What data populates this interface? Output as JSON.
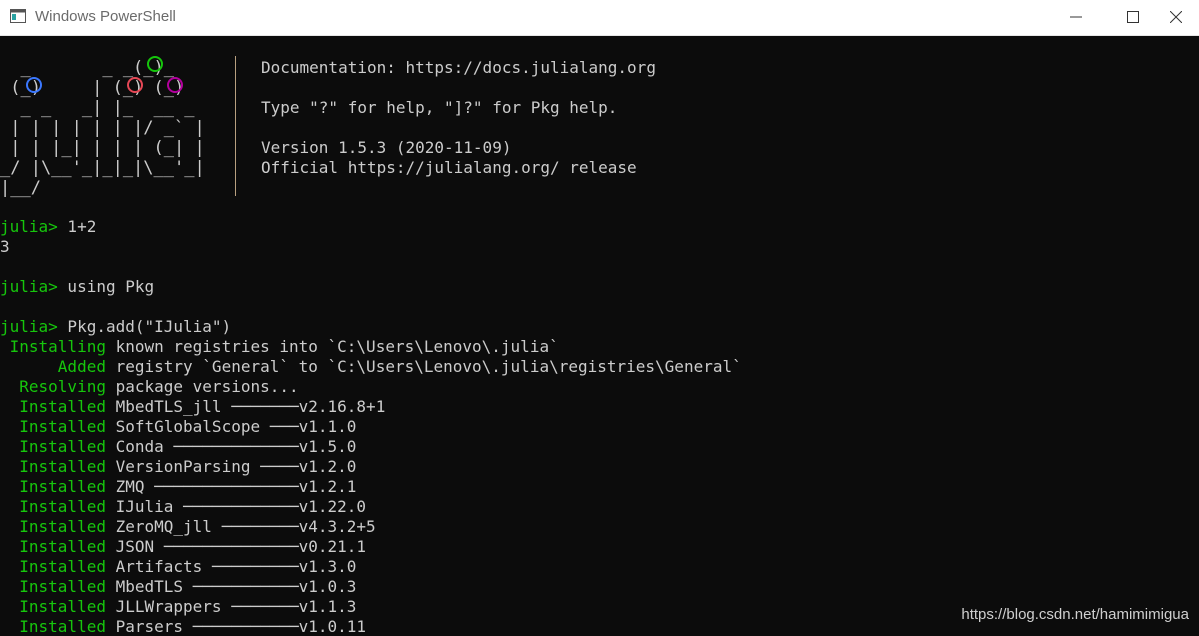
{
  "window": {
    "title": "Windows PowerShell"
  },
  "banner": {
    "documentation": "Documentation: https://docs.julialang.org",
    "help": "Type \"?\" for help, \"]?\" for Pkg help.",
    "version": "Version 1.5.3 (2020-11-09)",
    "release": "Official https://julialang.org/ release",
    "ascii_art": [
      "  _       _ _(_)_     ",
      " (_)     | (_) (_)    ",
      "  _ _   _| |_  __ _   ",
      " | | | | | | |/ _` |  ",
      " | | |_| | | | (_| |  ",
      "_/ |\\__'_|_|_|\\__'_|  ",
      "|__/                  "
    ],
    "dot_colors": {
      "green": "#16c60c",
      "blue": "#3b78ff",
      "red": "#e74856",
      "purple": "#b4009e"
    }
  },
  "session": {
    "prompt": "julia>",
    "commands": [
      {
        "input": " 1+2",
        "output": "3"
      },
      {
        "input": " using Pkg"
      },
      {
        "input": " Pkg.add(\"IJulia\")"
      }
    ],
    "log": [
      {
        "tag": " Installing",
        "text": " known registries into `C:\\Users\\Lenovo\\.julia`"
      },
      {
        "tag": "      Added",
        "text": " registry `General` to `C:\\Users\\Lenovo\\.julia\\registries\\General`"
      },
      {
        "tag": "  Resolving",
        "text": " package versions..."
      },
      {
        "tag": "  Installed",
        "text": " MbedTLS_jll ───────v2.16.8+1"
      },
      {
        "tag": "  Installed",
        "text": " SoftGlobalScope ───v1.1.0"
      },
      {
        "tag": "  Installed",
        "text": " Conda ─────────────v1.5.0"
      },
      {
        "tag": "  Installed",
        "text": " VersionParsing ────v1.2.0"
      },
      {
        "tag": "  Installed",
        "text": " ZMQ ───────────────v1.2.1"
      },
      {
        "tag": "  Installed",
        "text": " IJulia ────────────v1.22.0"
      },
      {
        "tag": "  Installed",
        "text": " ZeroMQ_jll ────────v4.3.2+5"
      },
      {
        "tag": "  Installed",
        "text": " JSON ──────────────v0.21.1"
      },
      {
        "tag": "  Installed",
        "text": " Artifacts ─────────v1.3.0"
      },
      {
        "tag": "  Installed",
        "text": " MbedTLS ───────────v1.0.3"
      },
      {
        "tag": "  Installed",
        "text": " JLLWrappers ───────v1.1.3"
      },
      {
        "tag": "  Installed",
        "text": " Parsers ───────────v1.0.11"
      }
    ]
  },
  "watermark": "https://blog.csdn.net/hamimimigua",
  "colors": {
    "background": "#0c0c0c",
    "text": "#cccccc",
    "prompt_green": "#16c60c"
  }
}
